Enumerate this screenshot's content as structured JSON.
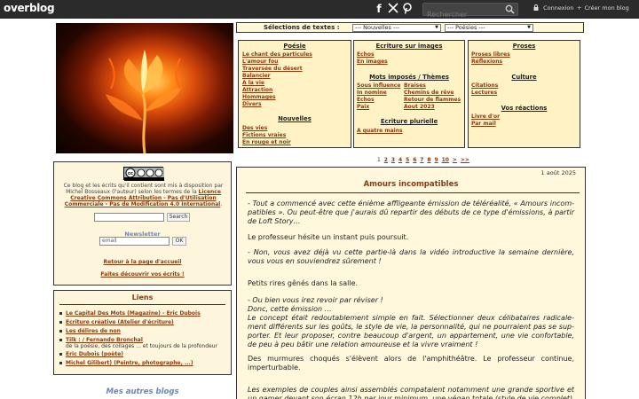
{
  "topbar": {
    "logo_prefix": "over",
    "logo_suffix": "blog",
    "social": [
      "facebook-icon",
      "x-icon",
      "pinterest-icon"
    ],
    "search_placeholder": "Rechercher",
    "connexion": "Connexion",
    "create_blog": "Créer mon blog"
  },
  "selection": {
    "label": "Sélections de textes :",
    "select1": "--- Nouvelles ---",
    "select2": "--- Poésies ---"
  },
  "menus": {
    "poesie": {
      "title": "Poésie",
      "items": [
        "Le chant des particules",
        "L'amour fou",
        "Traversée du désert",
        "Balancier",
        "A la vie",
        "Attraction",
        "Hommages",
        "Divers"
      ]
    },
    "nouvelles": {
      "title": "Nouvelles",
      "items": [
        "Des vies",
        "Fictions vraies",
        "En rouge et noir"
      ]
    },
    "ecriture_images": {
      "title": "Ecriture sur images",
      "items": [
        "Echos",
        "En images"
      ]
    },
    "mots_imposes": {
      "title": "Mots imposés / Thèmes",
      "col1": [
        "Sous influence",
        "In nomine",
        "Echos",
        "Paix"
      ],
      "col2": [
        "Braises",
        "Chemins de rêve",
        "Retour de flammes",
        "Aout 2023"
      ]
    },
    "ecriture_plurielle": {
      "title": "Ecriture plurielle",
      "items": [
        "A quatre mains"
      ]
    },
    "proses": {
      "title": "Proses",
      "items": [
        "Proses libres",
        "Réflexions"
      ]
    },
    "culture": {
      "title": "Culture",
      "items": [
        "Citations",
        "Lectures"
      ]
    },
    "vos_reactions": {
      "title": "Vos réactions",
      "items": [
        "Livre d'or",
        "Par mail"
      ]
    }
  },
  "pager": {
    "current": "1",
    "pages": [
      "2",
      "3",
      "4",
      "5",
      "6",
      "7",
      "8",
      "9",
      "10"
    ],
    "next": ">",
    "last": ">>"
  },
  "license": {
    "text_before": "Ce blog et les écrits qu'il contient sont mis à disposition par Michel Bosseaux (l'auteur) selon les termes de la ",
    "link": "Licence Creative Commons Attribution - Pas d'Utilisation Commerciale - Pas de Modification 4.0 International",
    "text_after": ".",
    "search_button": "Search",
    "newsletter": "Newsletter",
    "email_placeholder": "email",
    "ok_button": "OK",
    "retour": "Retour à la page d'accueil",
    "faites": "Faites découvrir vos écrits !"
  },
  "liens": {
    "title": "Liens",
    "items": [
      {
        "link": "Le Capital Des Mots (Magazine) - Eric Dubois",
        "sub": ""
      },
      {
        "link": "Ecriture créative (Atelier d'écriture)",
        "sub": ""
      },
      {
        "link": "Les délires de non",
        "sub": ""
      },
      {
        "link": "Tilk : / Fernando Bronchal",
        "sub": "de la poésie, des collages ... et toujours de la profondeur"
      },
      {
        "link": "Eric Dubois (poète)",
        "sub": ""
      },
      {
        "link": "Michel Gilibert) (Peintre, photographe, ...)",
        "sub": ""
      }
    ]
  },
  "autres_blogs": "Mes autres blogs",
  "article": {
    "date": "1 août 2025",
    "title": "Amours incompatibles",
    "p1": "- Tout a commencé avec cette énième affligeante émission de téléréalité, « Amours incom­patibles ». Ou peut-être que j'aurais dû repartir des débuts de ce type d'émissions, à partir de Loft Story…",
    "p2": "Le professeur hésite un instant puis poursuit.",
    "p3": "- Non, vous avez déjà vu cette partie-là dans la vidéo introductive la semaine dernière, vous vous en souviendrez sûrement !",
    "p4": "Petits rires gênés dans la salle.",
    "p5a": "- Ou bien vous irez revoir par réviser !",
    "p5b": "Donc, cette émission …",
    "p6": "Le concept était redoutablement simple en fait. Sélectionner deux célibataires radicale­ment différents sur les goûts, le style de vie, la personnalité, qui ne pourraient pas se sup­porter. Et leur proposer, contre beaucoup d'argent, un appartement, une vie confortable, de peu à peu bâtir une relation amoureuse et la vivre vraiment !",
    "p7": "Des murmures choqués s'élèvent alors de l'amphithéâtre. Le professeur continue, imperturbable.",
    "p8": "Les exemples de couples ainsi assemblés compataient notamment une grande sportive et un gamer devant son écran 12h par jour minimum, une végan totale (style de vie complet)"
  },
  "colors": {
    "accent_brown": "#8b3a0e",
    "accent_blue": "#6a86b8",
    "panel_bg": "#fff3c6"
  }
}
